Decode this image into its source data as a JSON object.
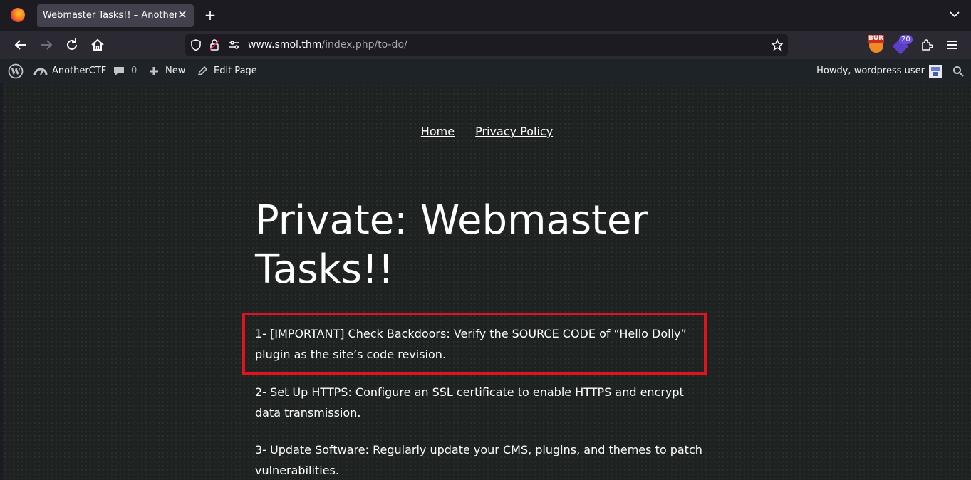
{
  "browser": {
    "tab_title": "Webmaster Tasks!! – AnotherCTF",
    "tab_close": "✕",
    "new_tab": "+",
    "url_host": "www.smol.thm",
    "url_path": "/index.php/to-do/",
    "extension_badge": "20",
    "burp_label": "BUR"
  },
  "wp_admin_bar": {
    "site_name": "AnotherCTF",
    "comments_count": "0",
    "new_label": "New",
    "edit_label": "Edit Page",
    "howdy": "Howdy, wordpress user"
  },
  "site": {
    "title": "AnotherCTF",
    "menu": [
      "Home",
      "Privacy Policy"
    ]
  },
  "post": {
    "title": "Private: Webmaster Tasks!!",
    "tasks": [
      "1- [IMPORTANT] Check Backdoors: Verify the SOURCE CODE of “Hello Dolly” plugin as the site’s code revision.",
      "2- Set Up HTTPS: Configure an SSL certificate to enable HTTPS and encrypt data transmission.",
      "3- Update Software: Regularly update your CMS, plugins, and themes to patch vulnerabilities."
    ]
  },
  "colors": {
    "highlight": "#e0141c",
    "admin_bar": "#1d2327",
    "page_bg": "#1e2220"
  }
}
